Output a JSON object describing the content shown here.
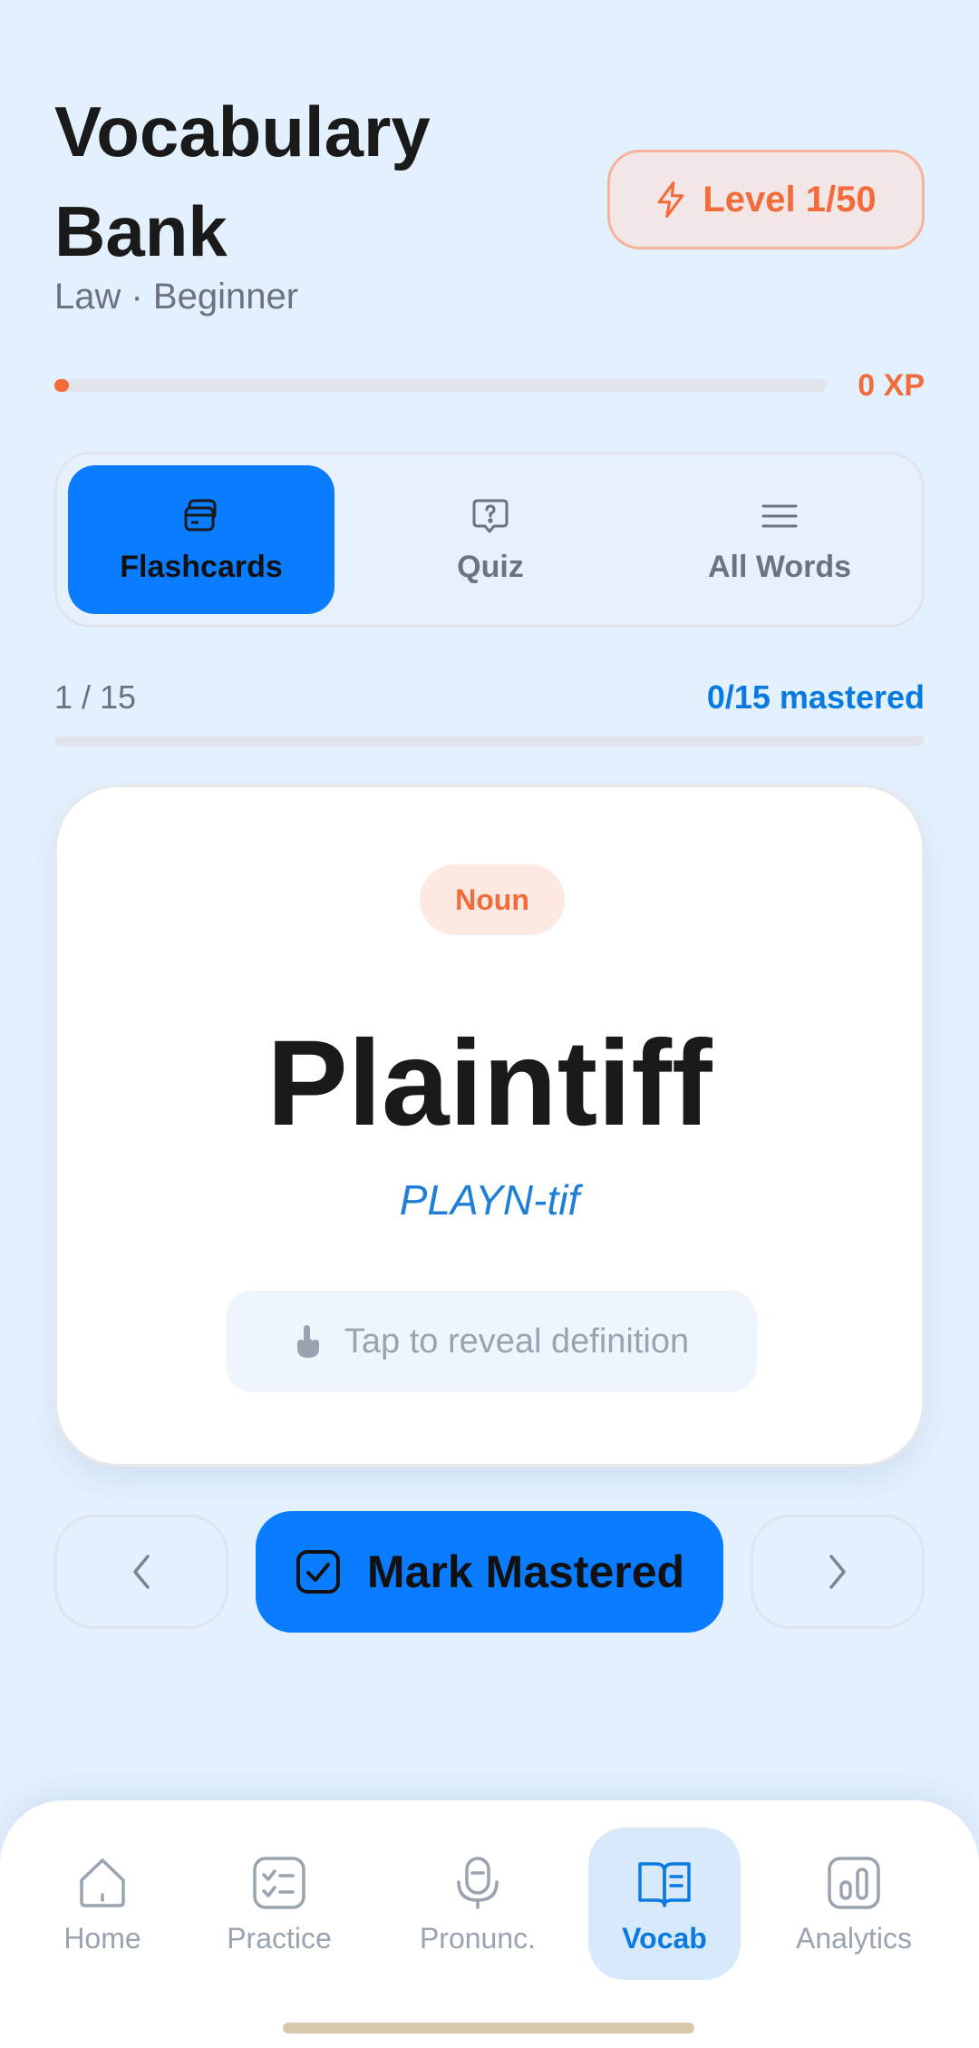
{
  "header": {
    "title": "Vocabulary Bank",
    "subtitle": "Law · Beginner",
    "level_label": "Level 1/50",
    "xp_label": "0 XP",
    "xp_progress": 0.0
  },
  "tabs": [
    {
      "label": "Flashcards",
      "icon": "cards-icon",
      "active": true
    },
    {
      "label": "Quiz",
      "icon": "quiz-bubble-icon",
      "active": false
    },
    {
      "label": "All Words",
      "icon": "list-icon",
      "active": false
    }
  ],
  "progress": {
    "position": "1 / 15",
    "mastered": "0/15 mastered",
    "fraction": 0.0
  },
  "card": {
    "part_of_speech": "Noun",
    "word": "Plaintiff",
    "pronunciation": "PLAYN-tif",
    "reveal_hint": "Tap to reveal definition"
  },
  "actions": {
    "mark_mastered": "Mark Mastered"
  },
  "bottom_nav": [
    {
      "label": "Home",
      "icon": "home-icon",
      "active": false
    },
    {
      "label": "Practice",
      "icon": "checklist-icon",
      "active": false
    },
    {
      "label": "Pronunc.",
      "icon": "microphone-icon",
      "active": false
    },
    {
      "label": "Vocab",
      "icon": "book-icon",
      "active": true
    },
    {
      "label": "Analytics",
      "icon": "bar-chart-icon",
      "active": false
    }
  ],
  "colors": {
    "accent": "#0a7cff",
    "xp_orange": "#f26b3a",
    "background": "#e3f0fd"
  }
}
